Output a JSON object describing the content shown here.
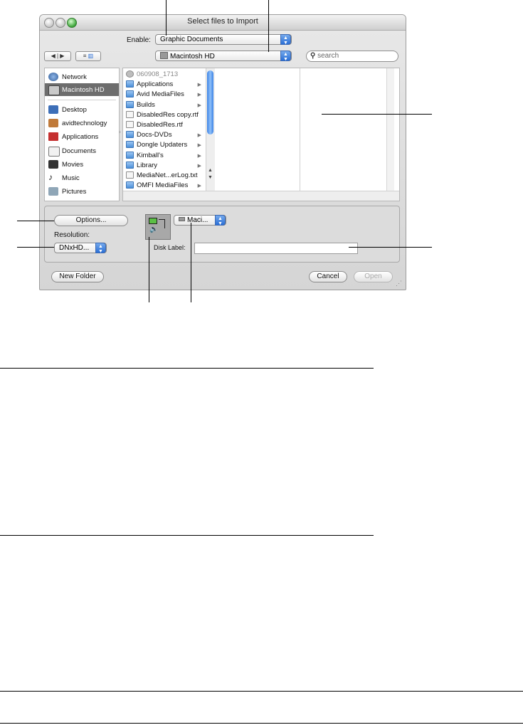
{
  "window": {
    "title": "Select files to Import"
  },
  "enable": {
    "label": "Enable:",
    "value": "Graphic Documents"
  },
  "location": {
    "value": "Macintosh HD"
  },
  "search": {
    "placeholder": "search"
  },
  "nav": {
    "back": "◀",
    "forward": "▶"
  },
  "sidebar": {
    "items": [
      {
        "label": "Network",
        "icon": "globe-icon"
      },
      {
        "label": "Macintosh HD",
        "icon": "hard-drive-icon",
        "selected": true
      },
      {
        "label": "Desktop",
        "icon": "desktop-icon"
      },
      {
        "label": "avidtechnology",
        "icon": "home-icon"
      },
      {
        "label": "Applications",
        "icon": "applications-icon"
      },
      {
        "label": "Documents",
        "icon": "documents-icon"
      },
      {
        "label": "Movies",
        "icon": "movies-icon"
      },
      {
        "label": "Music",
        "icon": "music-icon"
      },
      {
        "label": "Pictures",
        "icon": "pictures-icon"
      }
    ]
  },
  "files": [
    {
      "name": "060908_1713",
      "kind": "disk",
      "arrow": false,
      "dim": true
    },
    {
      "name": "Applications",
      "kind": "folder",
      "arrow": true
    },
    {
      "name": "Avid MediaFiles",
      "kind": "folder",
      "arrow": true
    },
    {
      "name": "Builds",
      "kind": "folder",
      "arrow": true
    },
    {
      "name": "DisabledRes copy.rtf",
      "kind": "doc",
      "arrow": false
    },
    {
      "name": "DisabledRes.rtf",
      "kind": "doc",
      "arrow": false
    },
    {
      "name": "Docs-DVDs",
      "kind": "folder",
      "arrow": true
    },
    {
      "name": "Dongle Updaters",
      "kind": "folder",
      "arrow": true
    },
    {
      "name": "Kimball's",
      "kind": "folder",
      "arrow": true
    },
    {
      "name": "Library",
      "kind": "folder",
      "arrow": true
    },
    {
      "name": "MediaNet...erLog.txt",
      "kind": "doc",
      "arrow": false
    },
    {
      "name": "OMFI MediaFiles",
      "kind": "folder",
      "arrow": true
    }
  ],
  "accessory": {
    "options_label": "Options...",
    "resolution_label": "Resolution:",
    "resolution_value": "DNxHD...",
    "drive_value": "Maci...",
    "disk_label": "Disk Label:",
    "disk_label_value": ""
  },
  "buttons": {
    "new_folder": "New Folder",
    "cancel": "Cancel",
    "open": "Open"
  },
  "colors": {
    "popup_arrow": "#2b6fd6",
    "selected_sidebar": "#6d6d6d",
    "scroll_thumb": "#3b82e6"
  }
}
